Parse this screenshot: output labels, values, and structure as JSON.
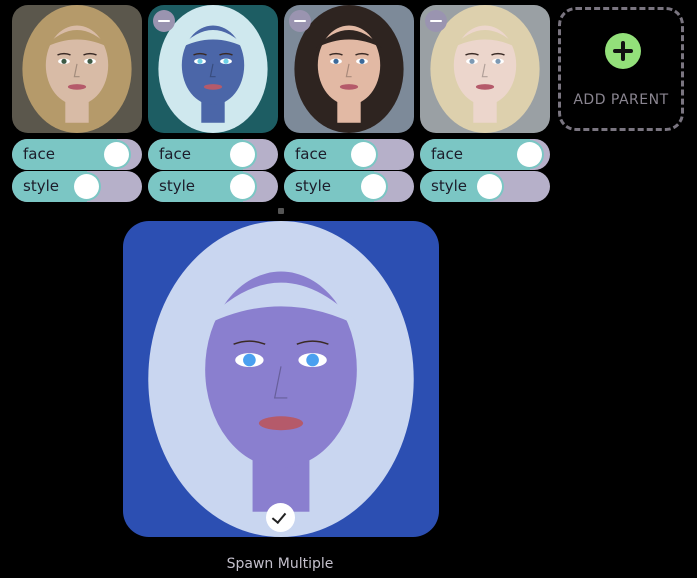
{
  "parents": [
    {
      "id": "p1",
      "removable": false,
      "portrait": {
        "bg": "#5b574c",
        "hair": "#b59a6a",
        "skin": "#d8bba6",
        "eye": "#3d5a45"
      },
      "face": {
        "label": "face",
        "value": 0.9
      },
      "style": {
        "label": "style",
        "value": 0.6
      }
    },
    {
      "id": "p2",
      "removable": true,
      "portrait": {
        "bg": "#1d5d63",
        "hair": "#cfe8ee",
        "skin": "#4b66a8",
        "eye": "#6fd0e6"
      },
      "face": {
        "label": "face",
        "value": 0.8
      },
      "style": {
        "label": "style",
        "value": 0.8
      }
    },
    {
      "id": "p3",
      "removable": true,
      "portrait": {
        "bg": "#7d8a99",
        "hair": "#2e2420",
        "skin": "#e2b9a4",
        "eye": "#3c6a9a"
      },
      "face": {
        "label": "face",
        "value": 0.65
      },
      "style": {
        "label": "style",
        "value": 0.75
      }
    },
    {
      "id": "p4",
      "removable": true,
      "portrait": {
        "bg": "#9aa0a4",
        "hair": "#ddd0ad",
        "skin": "#ecd6cc",
        "eye": "#7d99b3"
      },
      "face": {
        "label": "face",
        "value": 0.95
      },
      "style": {
        "label": "style",
        "value": 0.55
      }
    }
  ],
  "add_parent": {
    "label": "ADD PARENT"
  },
  "result": {
    "portrait": {
      "bg": "#2c4fb2",
      "hair": "#c9d6f0",
      "skin": "#8a7fcf",
      "eye": "#4aa0f0"
    }
  },
  "spawn_label": "Spawn Multiple",
  "colors": {
    "toggle_on": "#7bc6c4",
    "toggle_off": "#b6b0c9",
    "add_icon": "#93e07a"
  }
}
